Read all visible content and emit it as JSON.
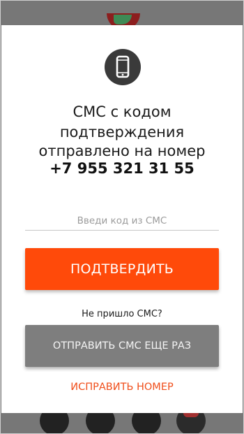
{
  "modal": {
    "icon": "phone-icon",
    "message_line1": "СМС с кодом",
    "message_line2": "подтверждения",
    "message_line3": "отправлено на номер",
    "phone_number": "+7 955 321 31 55",
    "code_input": {
      "value": "",
      "placeholder": "Введи код из СМС"
    },
    "confirm_label": "ПОДТВЕРДИТЬ",
    "no_sms_text": "Не пришло СМС?",
    "resend_label": "ОТПРАВИТЬ СМС ЕЩЕ РАЗ",
    "fix_number_label": "ИСПРАВИТЬ НОМЕР"
  },
  "colors": {
    "accent": "#ff4a0a",
    "link": "#f04e1a",
    "secondary_button": "#7e7e7e",
    "overlay": "#777777",
    "icon_badge": "#3a3a3a"
  }
}
